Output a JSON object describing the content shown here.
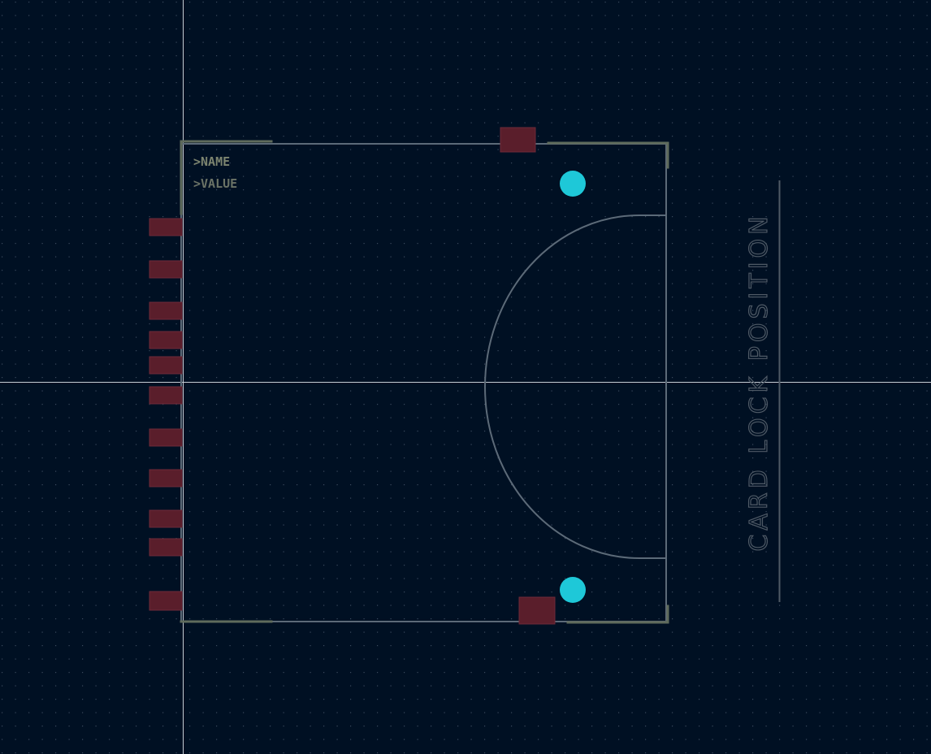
{
  "editor": {
    "theme": {
      "background": "#001023",
      "grid_dot": "#3b4a5e",
      "crosshair": "#c8ccd4",
      "fab_outline": "#5c6a78",
      "silkscreen": "#5f6b5c",
      "pad": "#5a1e2b",
      "pad_border": "#6e2a38",
      "hole": "#1ec8d8",
      "text_muted": "#4f5a66",
      "ref_text": "#7c846f"
    },
    "footprint": {
      "reference_text": ">NAME",
      "value_text": ">VALUE",
      "annotation_text": "CARD LOCK POSITION",
      "left_pad_count": 11,
      "mounting_holes": 2
    }
  }
}
